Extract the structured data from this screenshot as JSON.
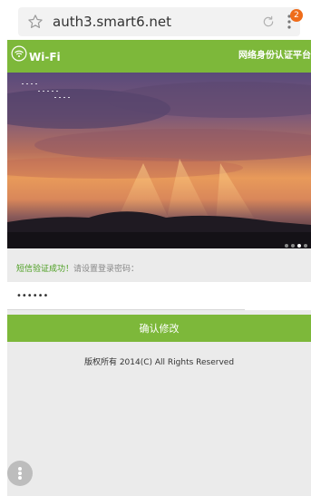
{
  "browser": {
    "url": "auth3.smart6.net",
    "notification_count": "2",
    "icons": [
      "star-icon",
      "reload-icon",
      "menu-icon"
    ]
  },
  "header": {
    "wifi_label": "Wi-Fi",
    "platform_title": "网络身份认证平台",
    "background_color": "#7db83a"
  },
  "banner": {
    "slides_total": 4,
    "active_slide": 3
  },
  "form": {
    "status_success": "短信验证成功！",
    "status_prompt": "请设置登录密码：",
    "password_value": "••••••",
    "submit_label": "确认修改"
  },
  "footer": {
    "copyright": "版权所有 2014(C) All Rights Reserved"
  },
  "colors": {
    "accent": "#7db83a",
    "success_text": "#4a9d1e",
    "badge": "#ef6c1a"
  }
}
